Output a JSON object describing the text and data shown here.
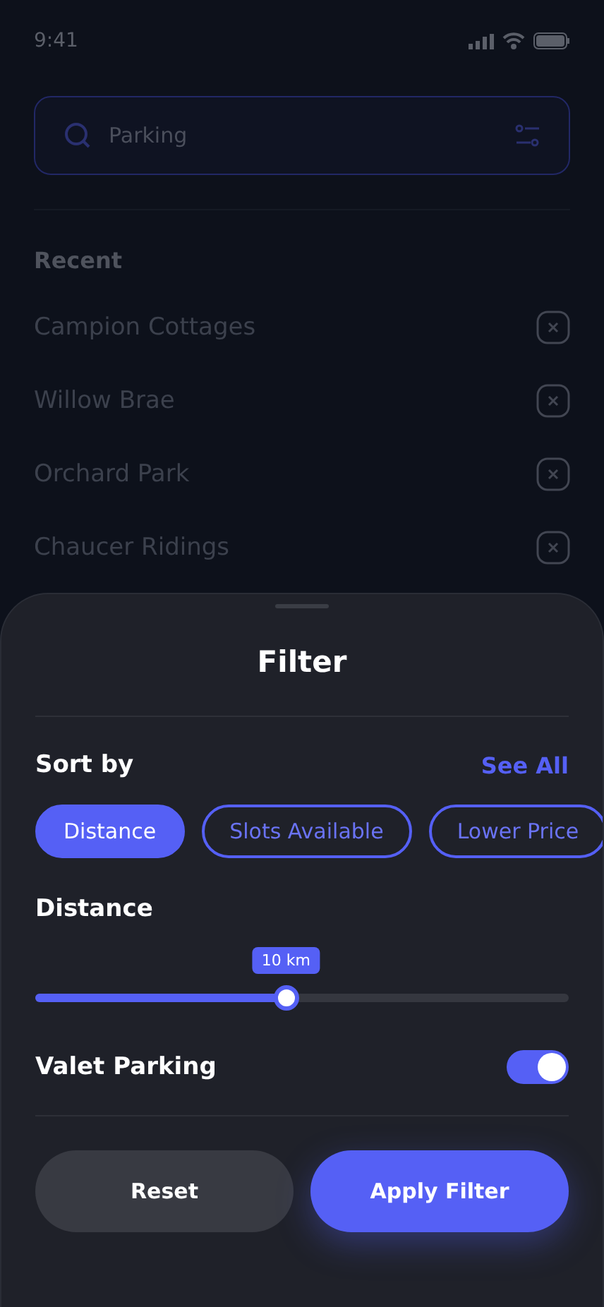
{
  "status_bar": {
    "time": "9:41"
  },
  "search": {
    "value": "Parking"
  },
  "recent": {
    "title": "Recent",
    "items": [
      {
        "label": "Campion Cottages"
      },
      {
        "label": "Willow Brae"
      },
      {
        "label": "Orchard Park"
      },
      {
        "label": "Chaucer Ridings"
      }
    ]
  },
  "filter_sheet": {
    "title": "Filter",
    "sort_by": {
      "label": "Sort by",
      "link": "See All",
      "options": [
        {
          "label": "Distance",
          "selected": true
        },
        {
          "label": "Slots Available",
          "selected": false
        },
        {
          "label": "Lower Price",
          "selected": false
        }
      ]
    },
    "distance": {
      "label": "Distance",
      "level": 0.47,
      "reading": "10 km"
    },
    "valet_parking": {
      "label": "Valet Parking",
      "on": true
    },
    "buttons": [
      {
        "label": "Reset",
        "kind": "secondary"
      },
      {
        "label": "Apply Filter",
        "kind": "primary"
      }
    ]
  }
}
